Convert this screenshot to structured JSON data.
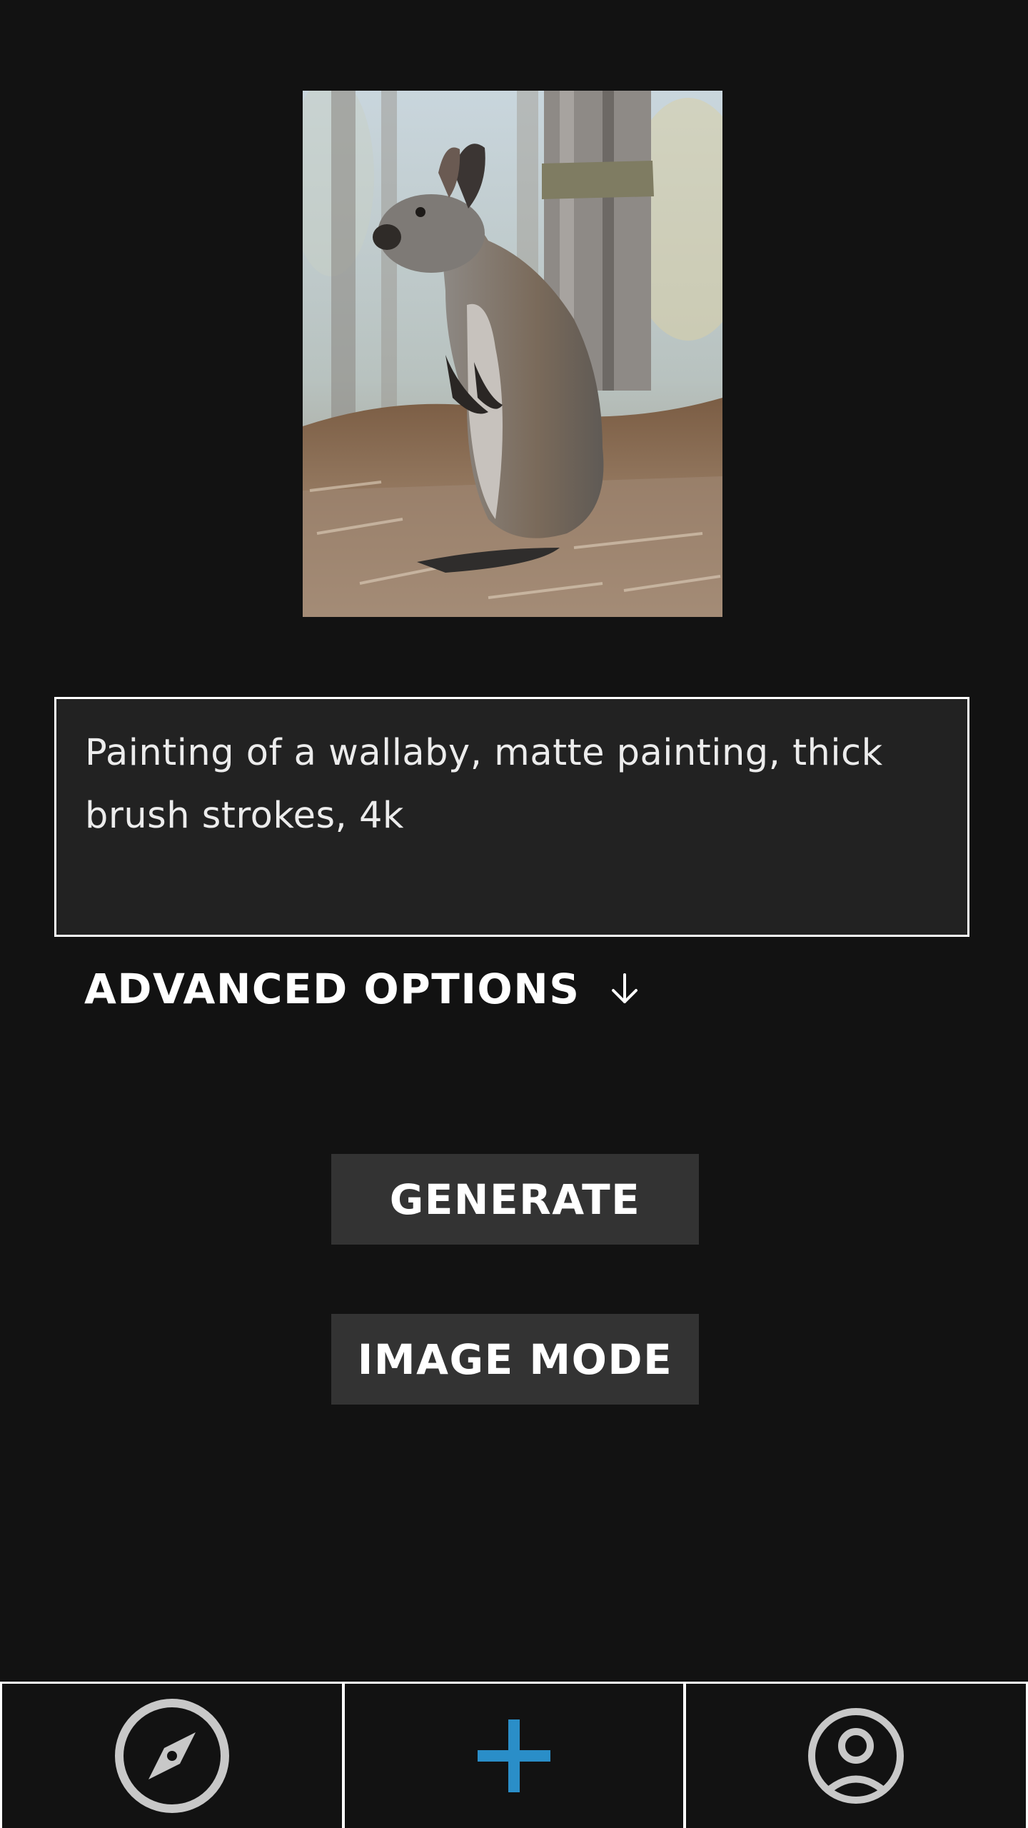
{
  "image": {
    "alt_icon": "wallaby-painting"
  },
  "prompt": {
    "value": "Painting of a wallaby, matte painting, thick brush strokes, 4k"
  },
  "advanced_options": {
    "label": "ADVANCED OPTIONS",
    "icon": "arrow-down-icon"
  },
  "buttons": {
    "generate": "GENERATE",
    "image_mode": "IMAGE MODE"
  },
  "bottom_nav": {
    "items": [
      {
        "icon": "compass-icon"
      },
      {
        "icon": "plus-icon"
      },
      {
        "icon": "user-circle-icon"
      }
    ]
  },
  "colors": {
    "background": "#121212",
    "prompt_bg": "#222222",
    "button_bg": "#333333",
    "accent": "#2a8ec8",
    "nav_icon": "#c8c8c8"
  }
}
